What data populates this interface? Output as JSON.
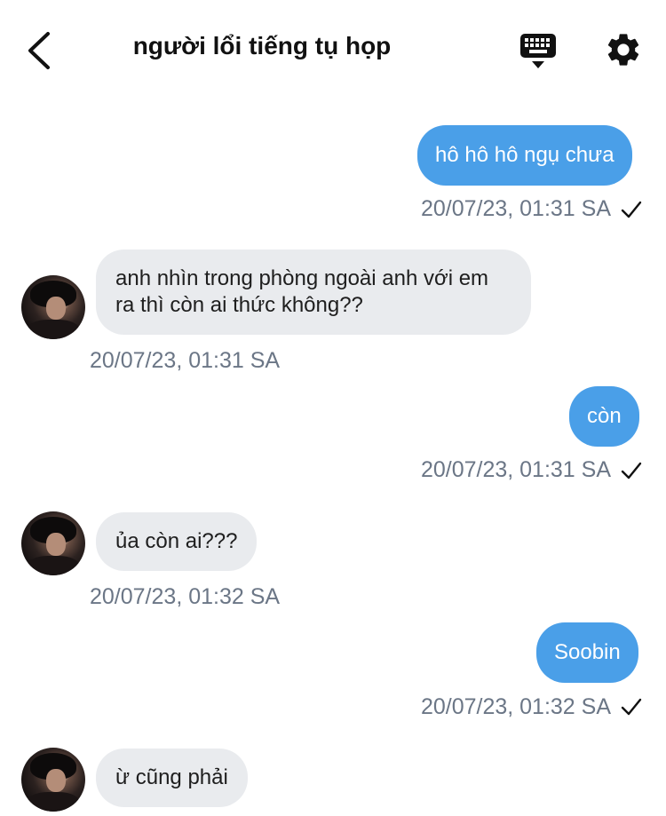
{
  "header": {
    "title": "người lổi tiếng tụ họp",
    "back_icon": "chevron-left-icon",
    "keyboard_icon": "keyboard-icon",
    "settings_icon": "gear-icon"
  },
  "messages": [
    {
      "direction": "out",
      "text": "hô hô hô ngụ chưa",
      "time": "20/07/23, 01:31 SA",
      "read": true
    },
    {
      "direction": "in",
      "text": "anh nhìn trong phòng ngoài anh với em ra thì còn ai thức không??",
      "time": "20/07/23, 01:31 SA"
    },
    {
      "direction": "out",
      "text": "còn",
      "time": "20/07/23, 01:31 SA",
      "read": true
    },
    {
      "direction": "in",
      "text": "ủa còn ai???",
      "time": "20/07/23, 01:32 SA"
    },
    {
      "direction": "out",
      "text": "Soobin",
      "time": "20/07/23, 01:32 SA",
      "read": true
    },
    {
      "direction": "in",
      "text": "ừ cũng phải",
      "time": ""
    }
  ],
  "colors": {
    "outgoing_bubble": "#4a9fe8",
    "incoming_bubble": "#e9ebee",
    "timestamp": "#6b7686"
  }
}
